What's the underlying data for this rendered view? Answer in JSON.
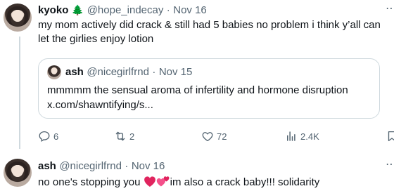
{
  "tweet1": {
    "display_name": "kyoko",
    "emoji": "🌲",
    "handle": "@hope_indecay",
    "separator": "·",
    "date": "Nov 16",
    "text": "my mom actively did crack & still had 5 babies no problem i think y’all can let the girlies enjoy lotion"
  },
  "quote": {
    "display_name": "ash",
    "handle": "@nicegirlfrnd",
    "separator": "·",
    "date": "Nov 15",
    "text": "mmmmm the sensual aroma of infertility and hormone disruption",
    "link": "x.com/shawntifying/s..."
  },
  "actions": {
    "replies": "6",
    "reposts": "2",
    "likes": "72",
    "views": "2.4K"
  },
  "tweet2": {
    "display_name": "ash",
    "handle": "@nicegirlfrnd",
    "separator": "·",
    "date": "Nov 16",
    "text_before": "no one's stopping you",
    "text_after": "im also a crack baby!!! solidarity"
  },
  "colors": {
    "text": "#0f1419",
    "muted": "#536471",
    "border": "#cfd9de",
    "heart_red": "#e0245e",
    "heart_pink": "#f4508a"
  },
  "icons": [
    "more-icon",
    "tree-emoji",
    "reply-icon",
    "repost-icon",
    "like-icon",
    "views-icon",
    "bookmark-icon",
    "heart-emoji",
    "two-hearts-emoji"
  ]
}
